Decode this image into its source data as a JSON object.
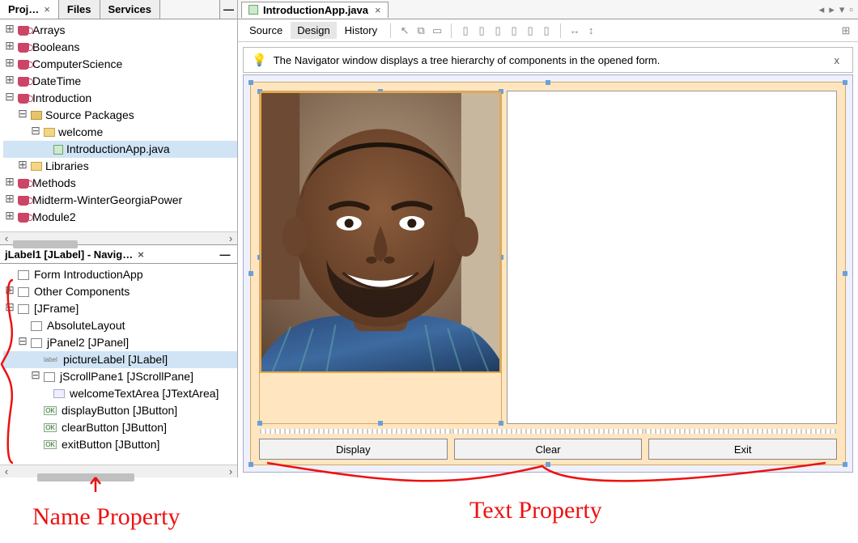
{
  "topTabs": {
    "projects": "Proj…",
    "files": "Files",
    "services": "Services"
  },
  "projectsTree": {
    "items": [
      "Arrays",
      "Booleans",
      "ComputerScience",
      "DateTime",
      "Introduction"
    ],
    "introduction": {
      "sourcePkgs": "Source Packages",
      "pkg": "welcome",
      "file": "IntroductionApp.java",
      "libraries": "Libraries"
    },
    "rest": [
      "Methods",
      "Midterm-WinterGeorgiaPower",
      "Module2"
    ]
  },
  "navigator": {
    "title": "jLabel1 [JLabel] - Navig…",
    "root": "Form IntroductionApp",
    "other": "Other Components",
    "frame": "[JFrame]",
    "layout": "AbsoluteLayout",
    "panel": "jPanel2 [JPanel]",
    "picture": "pictureLabel [JLabel]",
    "scroll": "jScrollPane1 [JScrollPane]",
    "textarea": "welcomeTextArea [JTextArea]",
    "display": "displayButton [JButton]",
    "clear": "clearButton [JButton]",
    "exit": "exitButton [JButton]"
  },
  "editor": {
    "fileTab": "IntroductionApp.java",
    "views": {
      "source": "Source",
      "design": "Design",
      "history": "History"
    },
    "hint": "The Navigator window displays a tree hierarchy of components in the opened form.",
    "hintClose": "x"
  },
  "buttons": {
    "display": "Display",
    "clear": "Clear",
    "exit": "Exit"
  },
  "annotations": {
    "name": "Name Property",
    "text": "Text Property"
  }
}
